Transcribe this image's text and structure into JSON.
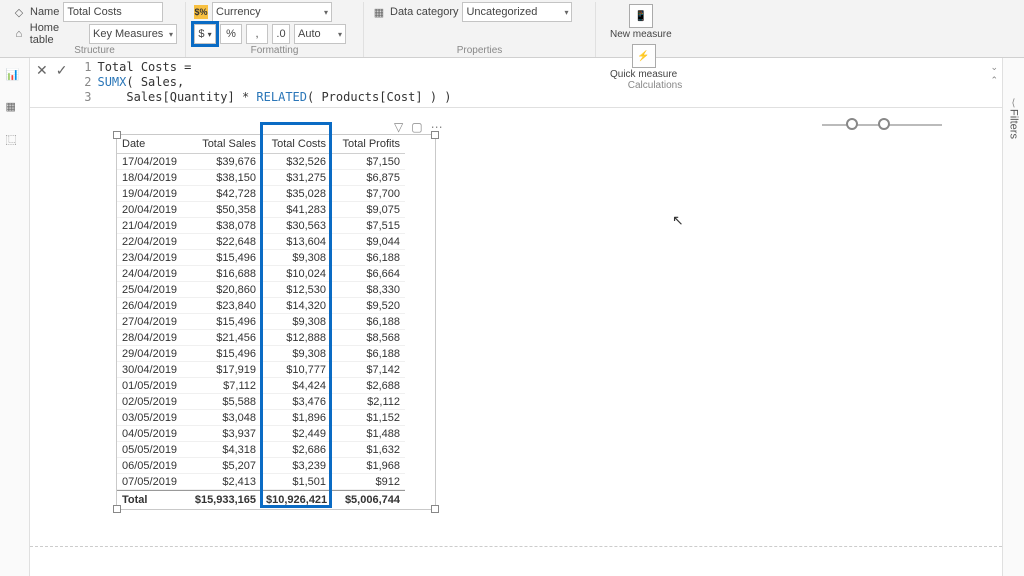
{
  "ribbon": {
    "name_label": "Name",
    "name_value": "Total Costs",
    "home_label": "Home table",
    "home_value": "Key Measures",
    "structure_label": "Structure",
    "format_label": "Currency",
    "currency_symbol": "$",
    "percent": "%",
    "comma": ",",
    "decimals_label": ".0",
    "decimals_value": "Auto",
    "formatting_label": "Formatting",
    "datacat_label": "Data category",
    "datacat_value": "Uncategorized",
    "properties_label": "Properties",
    "new_measure": "New measure",
    "quick_measure": "Quick measure",
    "calculations_label": "Calculations"
  },
  "formula": {
    "line1": "Total Costs =",
    "line2a": "SUMX",
    "line2b": "( Sales,",
    "line3a": "    Sales[Quantity] * ",
    "line3b": "RELATED",
    "line3c": "( Products[Cost] ) )"
  },
  "filters_label": "Filters",
  "visual": {
    "headers": [
      "Date",
      "Total Sales",
      "Total Costs",
      "Total Profits"
    ],
    "rows": [
      [
        "17/04/2019",
        "$39,676",
        "$32,526",
        "$7,150"
      ],
      [
        "18/04/2019",
        "$38,150",
        "$31,275",
        "$6,875"
      ],
      [
        "19/04/2019",
        "$42,728",
        "$35,028",
        "$7,700"
      ],
      [
        "20/04/2019",
        "$50,358",
        "$41,283",
        "$9,075"
      ],
      [
        "21/04/2019",
        "$38,078",
        "$30,563",
        "$7,515"
      ],
      [
        "22/04/2019",
        "$22,648",
        "$13,604",
        "$9,044"
      ],
      [
        "23/04/2019",
        "$15,496",
        "$9,308",
        "$6,188"
      ],
      [
        "24/04/2019",
        "$16,688",
        "$10,024",
        "$6,664"
      ],
      [
        "25/04/2019",
        "$20,860",
        "$12,530",
        "$8,330"
      ],
      [
        "26/04/2019",
        "$23,840",
        "$14,320",
        "$9,520"
      ],
      [
        "27/04/2019",
        "$15,496",
        "$9,308",
        "$6,188"
      ],
      [
        "28/04/2019",
        "$21,456",
        "$12,888",
        "$8,568"
      ],
      [
        "29/04/2019",
        "$15,496",
        "$9,308",
        "$6,188"
      ],
      [
        "30/04/2019",
        "$17,919",
        "$10,777",
        "$7,142"
      ],
      [
        "01/05/2019",
        "$7,112",
        "$4,424",
        "$2,688"
      ],
      [
        "02/05/2019",
        "$5,588",
        "$3,476",
        "$2,112"
      ],
      [
        "03/05/2019",
        "$3,048",
        "$1,896",
        "$1,152"
      ],
      [
        "04/05/2019",
        "$3,937",
        "$2,449",
        "$1,488"
      ],
      [
        "05/05/2019",
        "$4,318",
        "$2,686",
        "$1,632"
      ],
      [
        "06/05/2019",
        "$5,207",
        "$3,239",
        "$1,968"
      ],
      [
        "07/05/2019",
        "$2,413",
        "$1,501",
        "$912"
      ]
    ],
    "total_label": "Total",
    "totals": [
      "$15,933,165",
      "$10,926,421",
      "$5,006,744"
    ]
  }
}
